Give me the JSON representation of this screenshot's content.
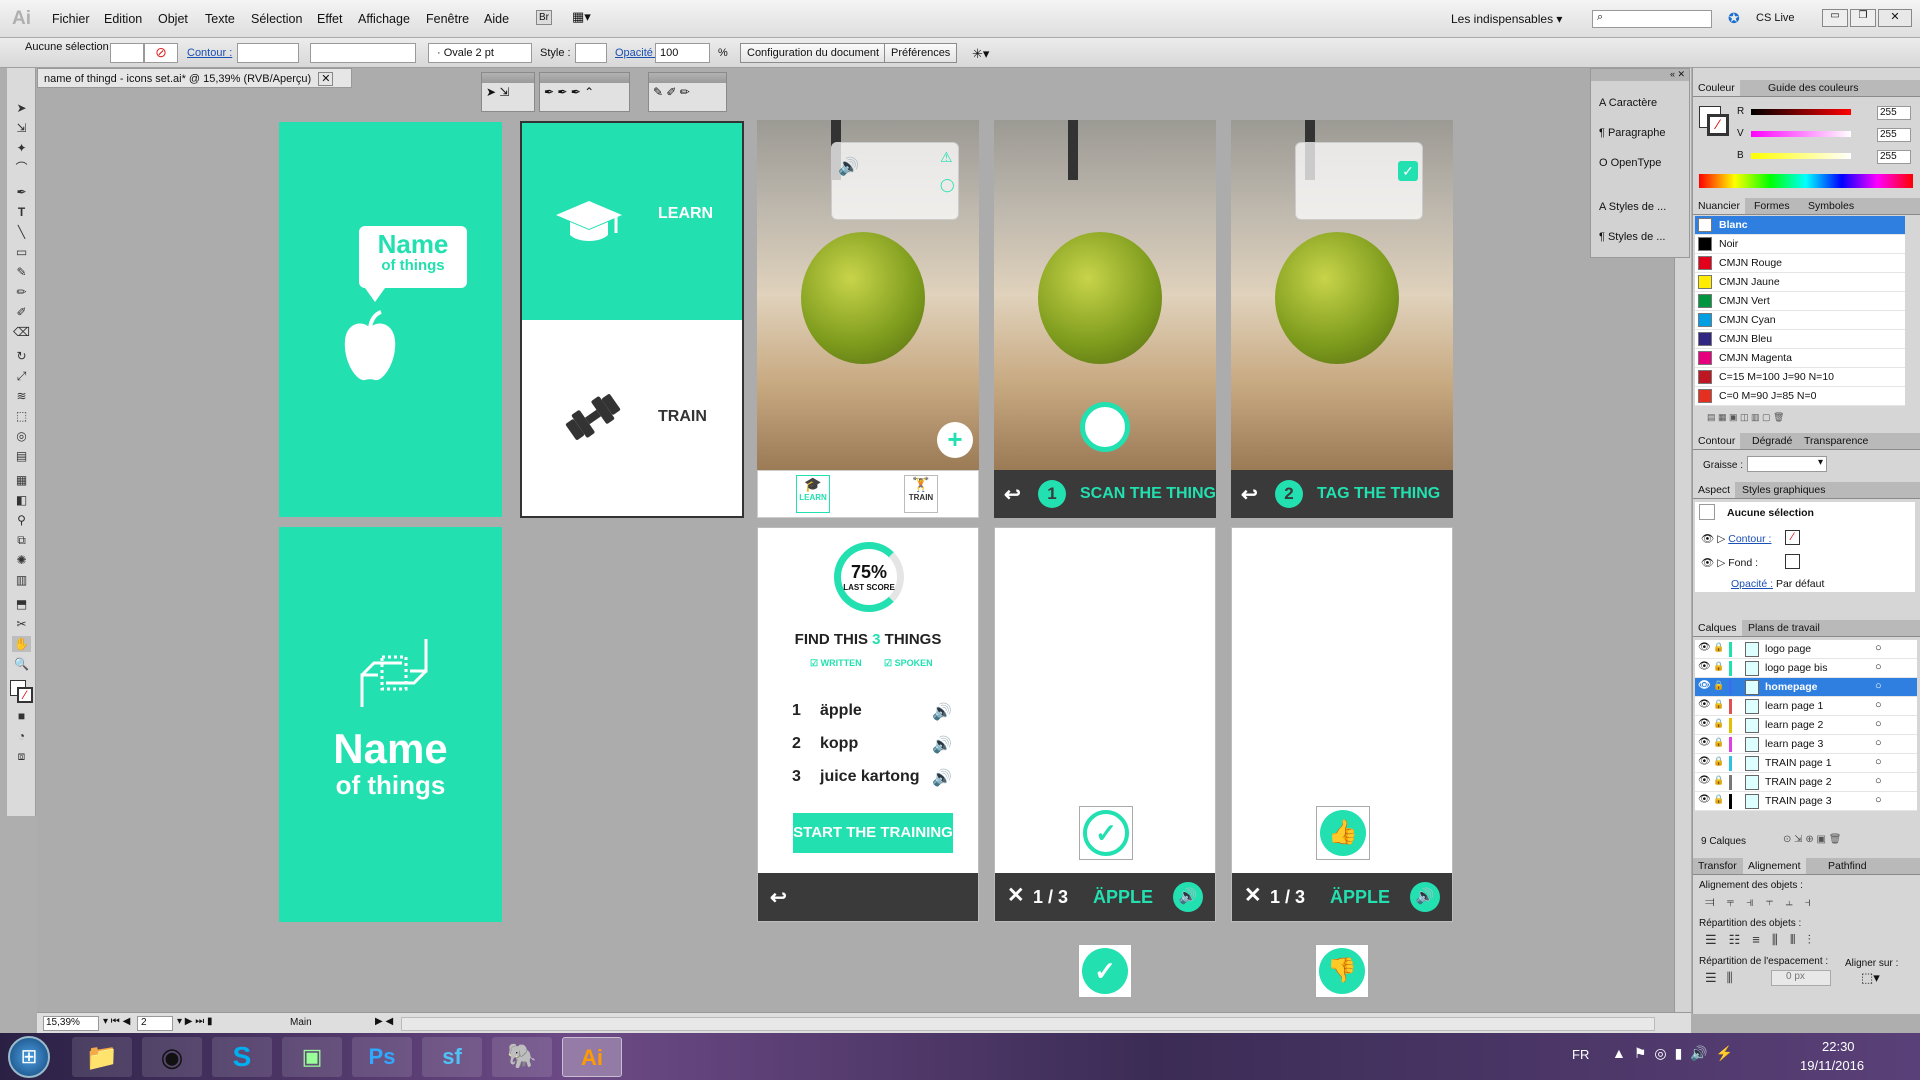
{
  "app": {
    "logo": "Ai",
    "menu": [
      "Fichier",
      "Edition",
      "Objet",
      "Texte",
      "Sélection",
      "Effet",
      "Affichage",
      "Fenêtre",
      "Aide"
    ],
    "bridge": "Br",
    "workspace": "Les indispensables",
    "cslive": "CS Live"
  },
  "control": {
    "selection": "Aucune sélection",
    "contour": "Contour :",
    "brush": "Ovale 2 pt",
    "style": "Style :",
    "opacity_label": "Opacité :",
    "opacity": "100",
    "pct": "%",
    "doc_setup": "Configuration du document",
    "prefs": "Préférences"
  },
  "doc": {
    "tab": "name of thingd - icons set.ai* @ 15,39% (RVB/Aperçu)"
  },
  "art": {
    "brand1": "Name",
    "brand2": "of things",
    "learn": "LEARN",
    "train": "TRAIN",
    "tab_learn": "LEARN",
    "tab_train": "TRAIN",
    "step1": "SCAN THE THING",
    "step2": "TAG THE THING",
    "n1": "1",
    "n2": "2",
    "score": "75%",
    "last": "LAST SCORE",
    "find_pre": "FIND THIS ",
    "find_num": "3",
    "find_post": " THINGS",
    "written": "WRITTEN",
    "spoken": "SPOKEN",
    "items": [
      {
        "n": "1",
        "w": "äpple"
      },
      {
        "n": "2",
        "w": "kopp"
      },
      {
        "n": "3",
        "w": "juice kartong"
      }
    ],
    "start": "START THE TRAINING",
    "count": "1 / 3",
    "word": "ÄPPLE"
  },
  "status": {
    "zoom": "15,39%",
    "page": "2",
    "artboard": "Main"
  },
  "panels": {
    "side": [
      "Caractère",
      "Paragraphe",
      "OpenType",
      "Styles de ...",
      "Styles de ..."
    ],
    "color_tabs": [
      "Couleur",
      "Guide des couleurs"
    ],
    "rgb": [
      {
        "k": "R",
        "v": "255"
      },
      {
        "k": "V",
        "v": "255"
      },
      {
        "k": "B",
        "v": "255"
      }
    ],
    "sw_tabs": [
      "Nuancier",
      "Formes",
      "Symboles"
    ],
    "swatches": [
      {
        "name": "Blanc",
        "c": "#ffffff"
      },
      {
        "name": "Noir",
        "c": "#000000"
      },
      {
        "name": "CMJN Rouge",
        "c": "#e3001b"
      },
      {
        "name": "CMJN Jaune",
        "c": "#ffec00"
      },
      {
        "name": "CMJN Vert",
        "c": "#009640"
      },
      {
        "name": "CMJN Cyan",
        "c": "#009fe3"
      },
      {
        "name": "CMJN Bleu",
        "c": "#312783"
      },
      {
        "name": "CMJN Magenta",
        "c": "#e6007e"
      },
      {
        "name": "C=15 M=100 J=90 N=10",
        "c": "#be1622"
      },
      {
        "name": "C=0 M=90 J=85 N=0",
        "c": "#e52f21"
      }
    ],
    "stroke_tabs": [
      "Contour",
      "Dégradé",
      "Transparence"
    ],
    "graisse": "Graisse :",
    "aspect_tabs": [
      "Aspect",
      "Styles graphiques"
    ],
    "aspect": {
      "none": "Aucune sélection",
      "contour": "Contour :",
      "fond": "Fond :",
      "opacite": "Opacité :",
      "defaut": "Par défaut"
    },
    "layer_tabs": [
      "Calques",
      "Plans de travail"
    ],
    "layers": [
      "logo page",
      "logo page bis",
      "homepage",
      "learn page 1",
      "learn page 2",
      "learn page 3",
      "TRAIN page 1",
      "TRAIN page 2",
      "TRAIN page 3"
    ],
    "layer_count": "9 Calques",
    "align_tabs": [
      "Transfor",
      "Alignement",
      "Pathfind"
    ],
    "align": {
      "objects": "Alignement des objets :",
      "repart": "Répartition des objets :",
      "space": "Répartition de l'espacement :",
      "alignon": "Aligner sur :",
      "px": "0 px"
    }
  },
  "taskbar": {
    "lang": "FR",
    "time": "22:30",
    "date": "19/11/2016"
  }
}
